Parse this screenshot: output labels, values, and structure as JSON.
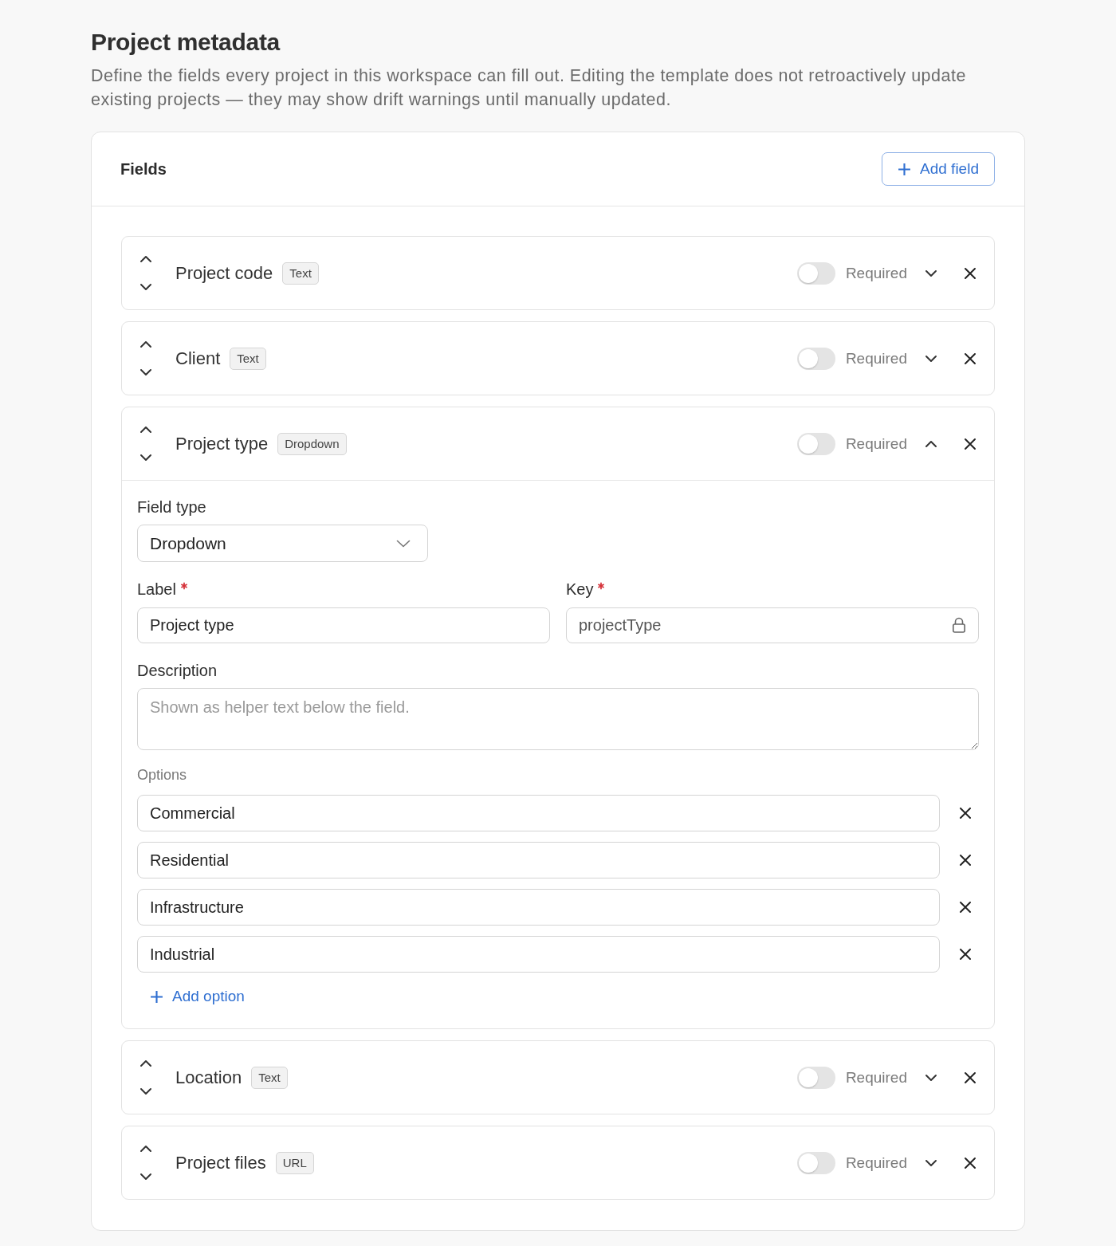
{
  "page": {
    "title": "Project metadata",
    "description": "Define the fields every project in this workspace can fill out. Editing the template does not retroactively update existing projects — they may show drift warnings until manually updated."
  },
  "fields_panel": {
    "title": "Fields",
    "add_button": "Add field",
    "fields": [
      {
        "name": "Project code",
        "type_badge": "Text",
        "required": false,
        "required_label": "Required",
        "expanded": false
      },
      {
        "name": "Client",
        "type_badge": "Text",
        "required": false,
        "required_label": "Required",
        "expanded": false
      },
      {
        "name": "Project type",
        "type_badge": "Dropdown",
        "required": false,
        "required_label": "Required",
        "expanded": true,
        "editor": {
          "field_type": {
            "label": "Field type",
            "value": "Dropdown"
          },
          "label_input": {
            "label": "Label",
            "required": true,
            "value": "Project type"
          },
          "key_input": {
            "label": "Key",
            "required": true,
            "value": "projectType",
            "locked": true
          },
          "description_input": {
            "label": "Description",
            "placeholder": "Shown as helper text below the field."
          },
          "options": {
            "label": "Options",
            "items": [
              {
                "value": "Commercial"
              },
              {
                "value": "Residential"
              },
              {
                "value": "Infrastructure"
              },
              {
                "value": "Industrial"
              }
            ],
            "add_button": "Add option"
          }
        }
      },
      {
        "name": "Location",
        "type_badge": "Text",
        "required": false,
        "required_label": "Required",
        "expanded": false
      },
      {
        "name": "Project files",
        "type_badge": "URL",
        "required": false,
        "required_label": "Required",
        "expanded": false
      }
    ]
  }
}
